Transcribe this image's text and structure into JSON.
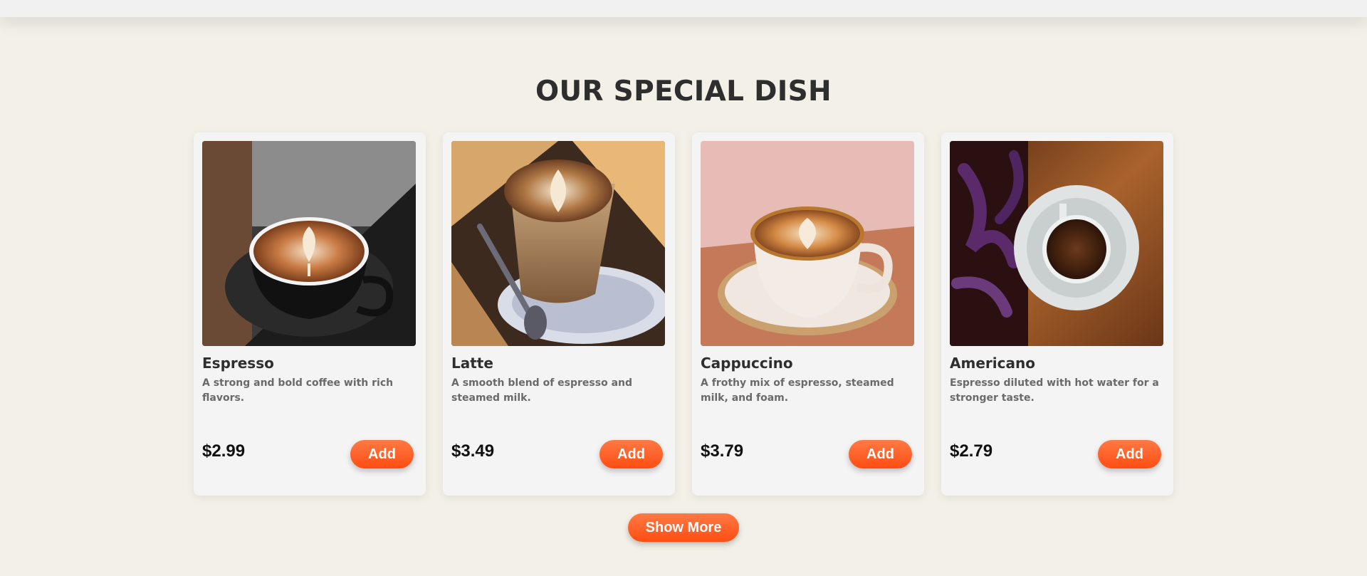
{
  "section": {
    "title": "OUR SPECIAL DISH"
  },
  "products": [
    {
      "name": "Espresso",
      "description": "A strong and bold coffee with rich flavors.",
      "price": "$2.99",
      "add_label": "Add",
      "image": "espresso-photo"
    },
    {
      "name": "Latte",
      "description": "A smooth blend of espresso and steamed milk.",
      "price": "$3.49",
      "add_label": "Add",
      "image": "latte-photo"
    },
    {
      "name": "Cappuccino",
      "description": "A frothy mix of espresso, steamed milk, and foam.",
      "price": "$3.79",
      "add_label": "Add",
      "image": "cappuccino-photo"
    },
    {
      "name": "Americano",
      "description": "Espresso diluted with hot water for a stronger taste.",
      "price": "$2.79",
      "add_label": "Add",
      "image": "americano-photo"
    }
  ],
  "show_more_label": "Show More",
  "colors": {
    "accent": "#ff5a1f",
    "background": "#f3f0e8",
    "card": "#f4f4f4",
    "title": "#2e2e2e"
  }
}
